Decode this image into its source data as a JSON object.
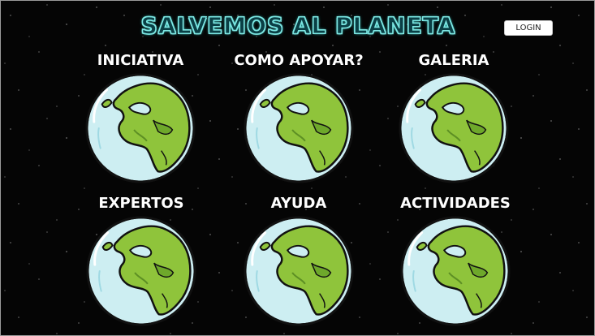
{
  "header": {
    "title": "SALVEMOS AL PLANETA",
    "login_label": "LOGIN"
  },
  "colors": {
    "background": "#050505",
    "title_glow": "#7fe7e3",
    "ocean": "#cdeef2",
    "land": "#8fc43b"
  },
  "menu": {
    "items": [
      {
        "label": "INICIATIVA",
        "icon": "earth-globe-icon"
      },
      {
        "label": "COMO APOYAR?",
        "icon": "earth-globe-icon"
      },
      {
        "label": "GALERIA",
        "icon": "earth-globe-icon"
      },
      {
        "label": "EXPERTOS",
        "icon": "earth-globe-icon"
      },
      {
        "label": "AYUDA",
        "icon": "earth-globe-icon"
      },
      {
        "label": "ACTIVIDADES",
        "icon": "earth-globe-icon"
      }
    ]
  }
}
